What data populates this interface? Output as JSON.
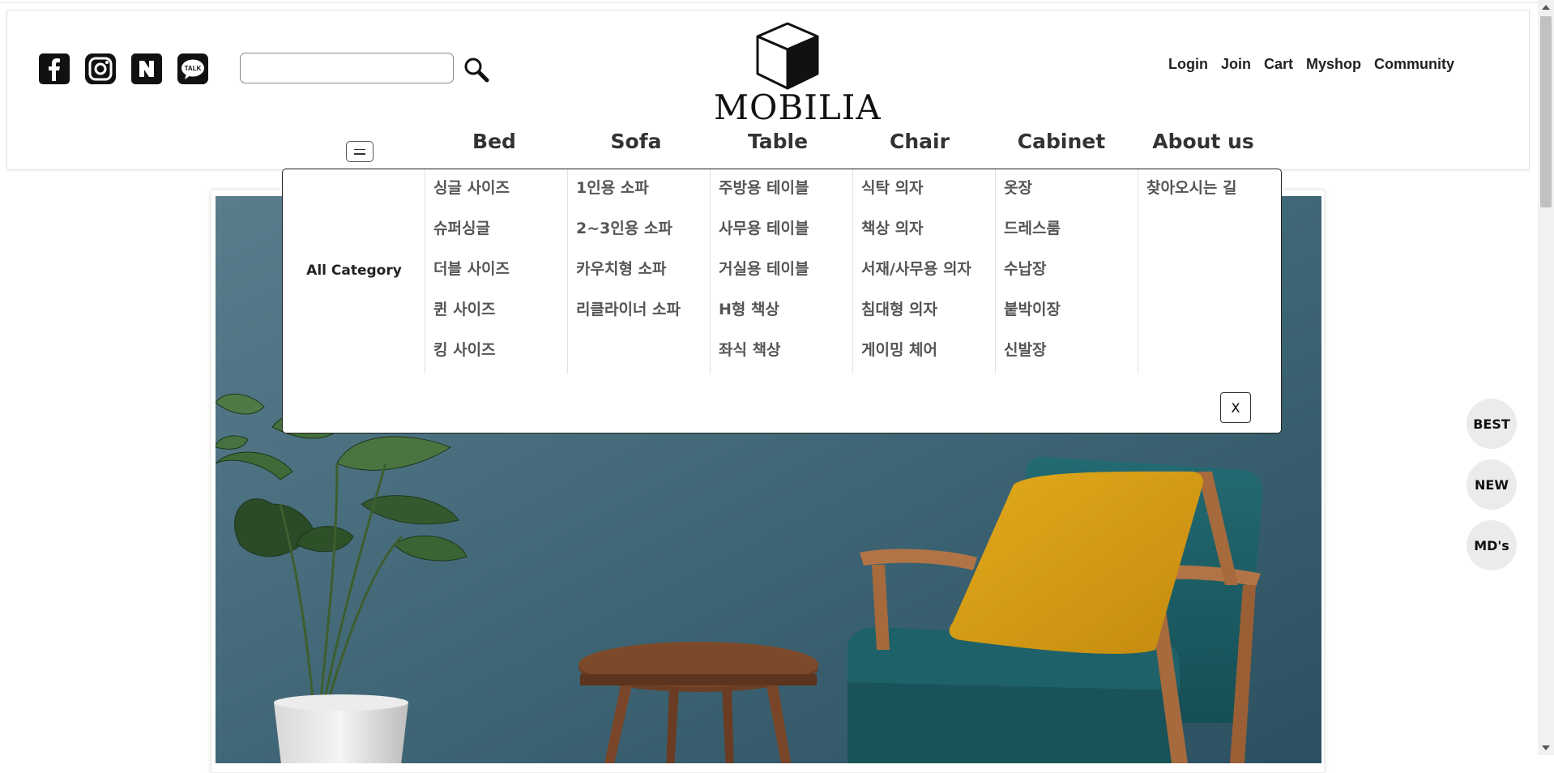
{
  "header": {
    "logo_text": "MOBILIA",
    "search": {
      "value": "",
      "placeholder": ""
    },
    "social_icons": [
      "facebook-icon",
      "instagram-icon",
      "naver-blog-icon",
      "kakaotalk-icon"
    ],
    "top_links": [
      "Login",
      "Join",
      "Cart",
      "Myshop",
      "Community"
    ]
  },
  "category_nav": {
    "items": [
      "Bed",
      "Sofa",
      "Table",
      "Chair",
      "Cabinet",
      "About us"
    ]
  },
  "dropdown": {
    "all_category_label": "All Category",
    "columns": [
      {
        "items": [
          "싱글 사이즈",
          "슈퍼싱글",
          "더블 사이즈",
          "퀸 사이즈",
          "킹 사이즈"
        ]
      },
      {
        "items": [
          "1인용 소파",
          "2~3인용 소파",
          "카우치형 소파",
          "리클라이너 소파"
        ]
      },
      {
        "items": [
          "주방용 테이블",
          "사무용 테이블",
          "거실용 테이블",
          "H형 책상",
          "좌식 책상"
        ]
      },
      {
        "items": [
          "식탁 의자",
          "책상 의자",
          "서재/사무용 의자",
          "침대형 의자",
          "게이밍 체어"
        ]
      },
      {
        "items": [
          "옷장",
          "드레스룸",
          "수납장",
          "붙박이장",
          "신발장"
        ]
      },
      {
        "items": [
          "찾아오시는 길"
        ]
      }
    ],
    "close_label": "X"
  },
  "side_badges": [
    "BEST",
    "NEW",
    "MD's"
  ],
  "colors": {
    "hero_wall": "#3f6676",
    "chair_fabric": "#1d5f66",
    "pillow": "#d79e16",
    "wood": "#a66a3c"
  }
}
